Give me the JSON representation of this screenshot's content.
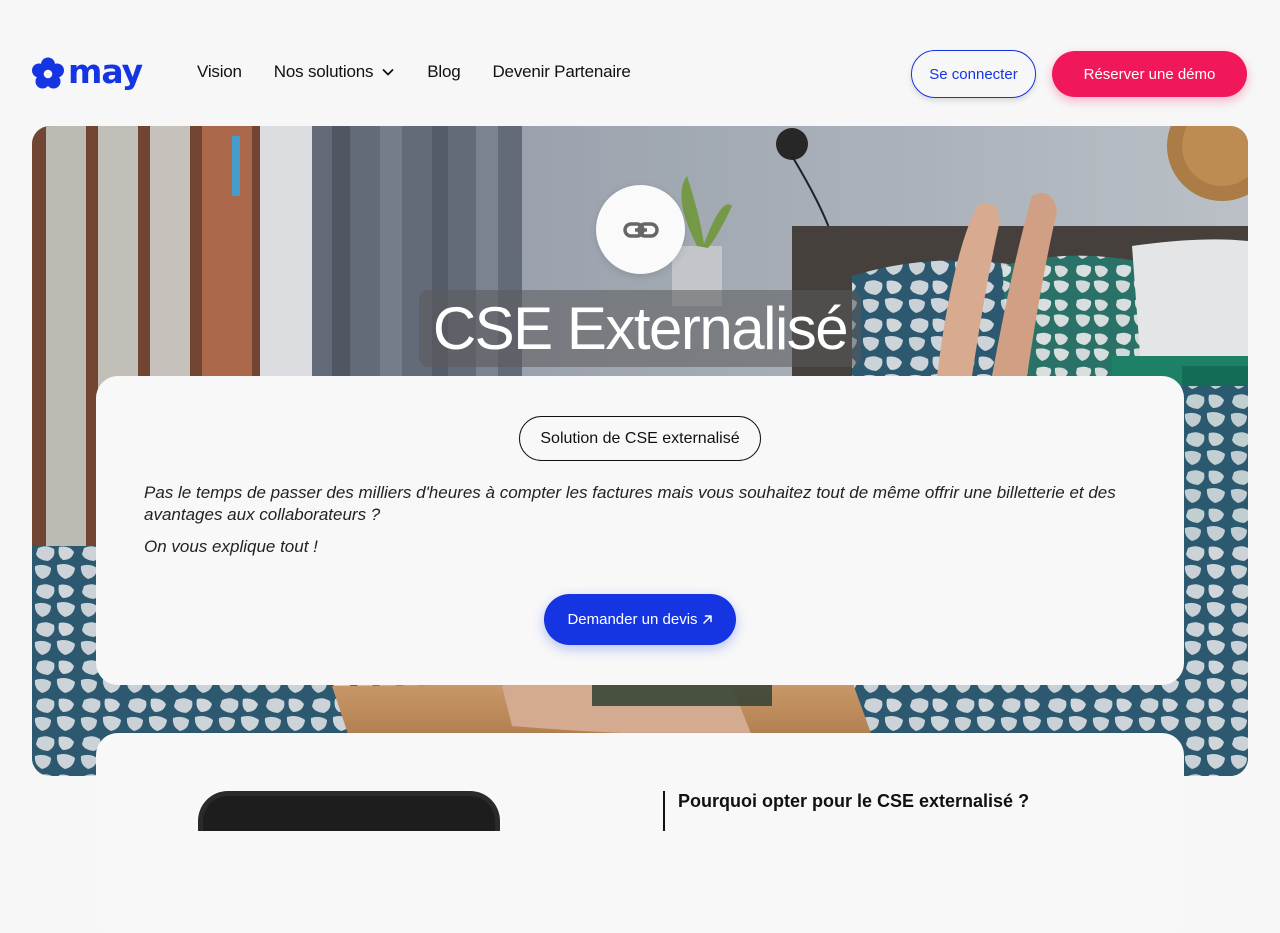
{
  "brand": {
    "logo_text": "may",
    "color": "#1535e3"
  },
  "nav": {
    "items": [
      {
        "label": "Vision"
      },
      {
        "label": "Nos solutions",
        "has_dropdown": true,
        "icon": "chevron-down-icon"
      },
      {
        "label": "Blog"
      },
      {
        "label": "Devenir Partenaire"
      }
    ]
  },
  "header": {
    "login_label": "Se connecter",
    "demo_label": "Réserver une démo"
  },
  "hero": {
    "icon": "link-icon",
    "title": "CSE Externalisé"
  },
  "card": {
    "tag": "Solution de CSE externalisé",
    "paragraph": "Pas le temps de passer des milliers d'heures à compter les factures mais vous souhaitez tout de même offrir une billetterie et des avantages aux collaborateurs ?",
    "paragraph2": "On vous explique tout !",
    "cta_label": "Demander un devis",
    "cta_icon": "arrow-up-right-icon"
  },
  "section2": {
    "question": "Pourquoi opter pour le CSE externalisé ?"
  },
  "colors": {
    "primary_blue": "#1535e3",
    "accent_pink": "#f0185a",
    "background": "#f7f7f7"
  }
}
